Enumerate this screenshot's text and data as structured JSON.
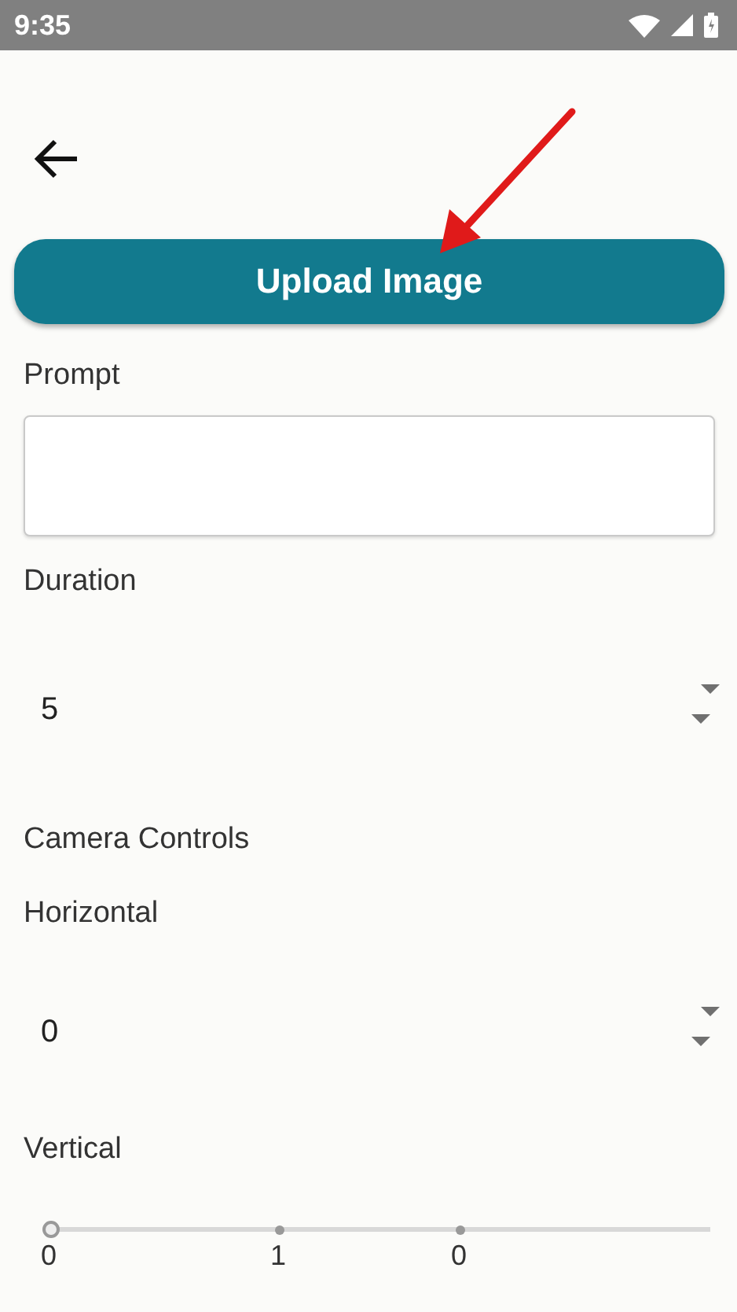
{
  "status_bar": {
    "time": "9:35"
  },
  "upload_button": {
    "label": "Upload Image"
  },
  "prompt": {
    "label": "Prompt"
  },
  "duration": {
    "label": "Duration",
    "value": "5"
  },
  "camera_controls": {
    "heading": "Camera Controls"
  },
  "horizontal": {
    "label": "Horizontal",
    "value": "0"
  },
  "vertical": {
    "label": "Vertical",
    "level": 0,
    "ticks": [
      "0",
      "1",
      "0"
    ]
  }
}
